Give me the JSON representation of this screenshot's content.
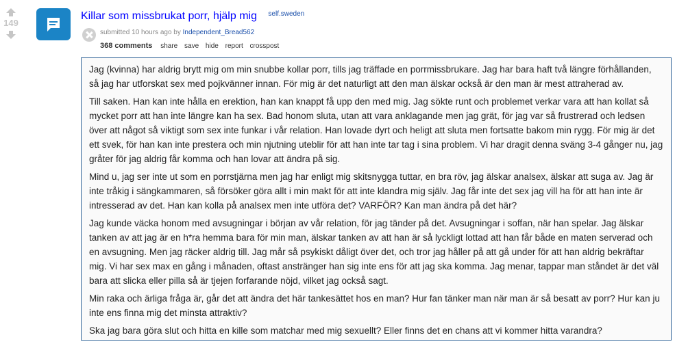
{
  "post": {
    "score": "149",
    "title": "Killar som missbrukat porr, hjälp mig",
    "domain": "self.sweden",
    "tagline_prefix": "submitted 10 hours ago by ",
    "author": "Independent_Bread562",
    "thumbnail_icon": "self-post-chat-icon"
  },
  "actions": {
    "comments": "368 comments",
    "share": "share",
    "save": "save",
    "hide": "hide",
    "report": "report",
    "crosspost": "crosspost"
  },
  "selftext": [
    "Jag (kvinna) har aldrig brytt mig om min snubbe kollar porr, tills jag träffade en porrmissbrukare. Jag har bara haft två längre förhållanden, så jag har utforskat sex med pojkvänner innan. För mig är det naturligt att den man älskar också är den man är mest attraherad av.",
    "Till saken. Han kan inte hålla en erektion, han kan knappt få upp den med mig. Jag sökte runt och problemet verkar vara att han kollat så mycket porr att han inte längre kan ha sex. Bad honom sluta, utan att vara anklagande men jag grät, för jag var så frustrerad och ledsen över att något så viktigt som sex inte funkar i vår relation. Han lovade dyrt och heligt att sluta men fortsatte bakom min rygg. För mig är det ett svek, för han kan inte prestera och min njutning uteblir för att han inte tar tag i sina problem. Vi har dragit denna sväng 3-4 gånger nu, jag gråter för jag aldrig får komma och han lovar att ändra på sig.",
    "Mind u, jag ser inte ut som en porrstjärna men jag har enligt mig skitsnygga tuttar, en bra röv, jag älskar analsex, älskar att suga av. Jag är inte tråkig i sängkammaren, så försöker göra allt i min makt för att inte klandra mig själv. Jag får inte det sex jag vill ha för att han inte är intresserad av det. Han kan kolla på analsex men inte utföra det? VARFÖR? Kan man ändra på det här?",
    "Jag kunde väcka honom med avsugningar i början av vår relation, för jag tänder på det. Avsugningar i soffan, när han spelar. Jag älskar tanken av att jag är en h*ra hemma bara för min man, älskar tanken av att han är så lyckligt lottad att han får både en maten serverad och en avsugning. Men jag räcker aldrig till. Jag mår så psykiskt dåligt över det, och tror jag håller på att gå under för att han aldrig bekräftar mig. Vi har sex max en gång i månaden, oftast anstränger han sig inte ens för att jag ska komma. Jag menar, tappar man ståndet är det väl bara att slicka eller pilla så är tjejen forfarande nöjd, vilket jag också sagt.",
    "Min raka och ärliga fråga är, går det att ändra det här tankesättet hos en man? Hur fan tänker man när man är så besatt av porr? Hur kan ju inte ens finna mig det minsta attraktiv?",
    "Ska jag bara göra slut och hitta en kille som matchar med mig sexuellt? Eller finns det en chans att vi kommer hitta varandra?"
  ]
}
